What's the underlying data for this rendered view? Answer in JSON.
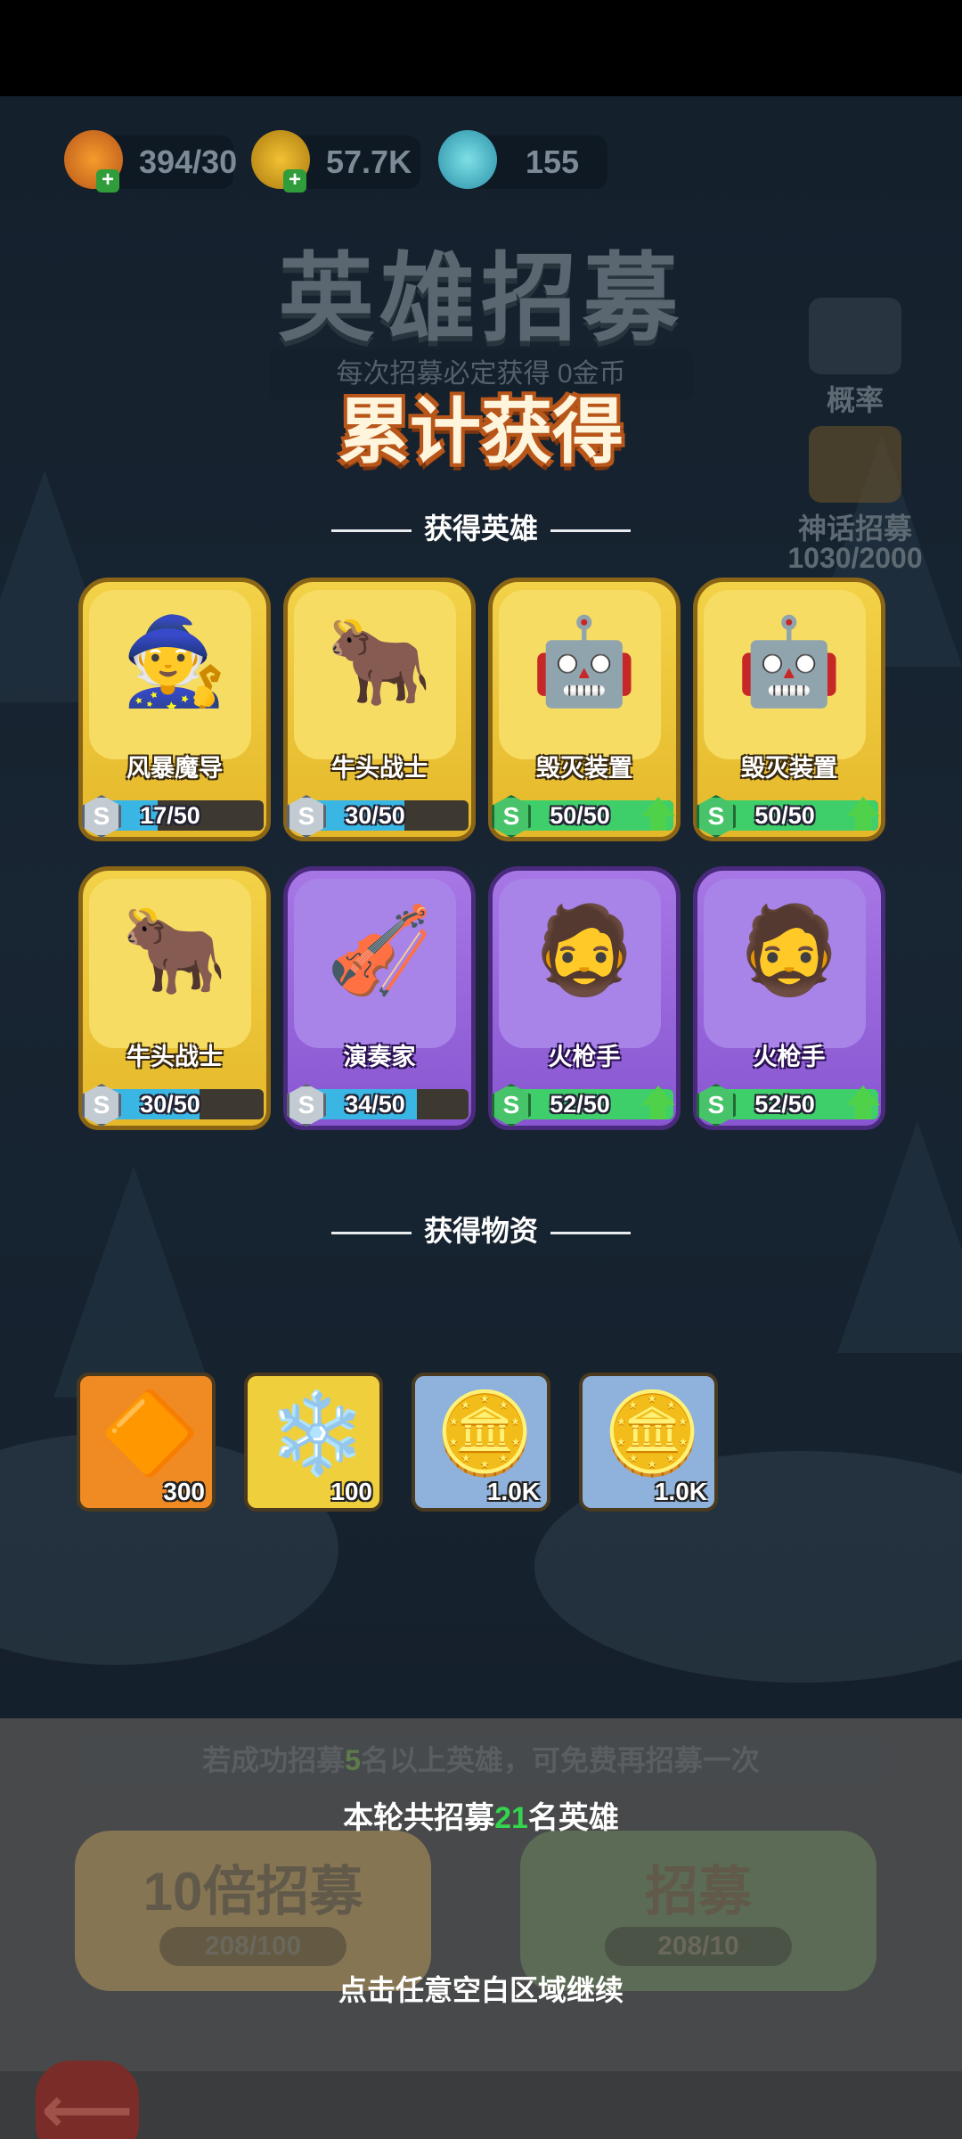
{
  "resources": [
    {
      "name": "fire-crystal-icon",
      "value": "394/30"
    },
    {
      "name": "gold-coin-icon",
      "value": "57.7K"
    },
    {
      "name": "ice-crystal-icon",
      "value": "155"
    }
  ],
  "background": {
    "title": "英雄招募",
    "subtitle": "每次招募必定获得 0金币",
    "odds_label": "概率",
    "mythic_label": "神话招募",
    "mythic_progress": "1030/2000"
  },
  "panel": {
    "title": "累计获得",
    "heroes_section": "获得英雄",
    "items_section": "获得物资"
  },
  "heroes": [
    {
      "name": "风暴魔导",
      "progress": "17/50",
      "fraction": 0.34,
      "rarity": "gold",
      "art": "🧙",
      "badge": "S"
    },
    {
      "name": "牛头战士",
      "progress": "30/50",
      "fraction": 0.6,
      "rarity": "gold",
      "art": "🐂",
      "badge": "S"
    },
    {
      "name": "毁灭装置",
      "progress": "50/50",
      "fraction": 1.0,
      "rarity": "gold",
      "art": "🤖",
      "badge": "S"
    },
    {
      "name": "毁灭装置",
      "progress": "50/50",
      "fraction": 1.0,
      "rarity": "gold",
      "art": "🤖",
      "badge": "S"
    },
    {
      "name": "牛头战士",
      "progress": "30/50",
      "fraction": 0.6,
      "rarity": "gold",
      "art": "🐂",
      "badge": "S"
    },
    {
      "name": "演奏家",
      "progress": "34/50",
      "fraction": 0.68,
      "rarity": "purple",
      "art": "🎻",
      "badge": "S"
    },
    {
      "name": "火枪手",
      "progress": "52/50",
      "fraction": 1.0,
      "rarity": "purple",
      "art": "🧔",
      "badge": "S"
    },
    {
      "name": "火枪手",
      "progress": "52/50",
      "fraction": 1.0,
      "rarity": "purple",
      "art": "🧔",
      "badge": "S"
    }
  ],
  "items": [
    {
      "icon": "fire-crystal-icon",
      "glyph": "🔶",
      "count": "300",
      "bg": "#f08a22"
    },
    {
      "icon": "ice-crystal-icon",
      "glyph": "❄️",
      "count": "100",
      "bg": "#f0cf3c"
    },
    {
      "icon": "gold-coin-icon",
      "glyph": "🪙",
      "count": "1.0K",
      "bg": "#8fb2dc"
    },
    {
      "icon": "gold-coin-icon",
      "glyph": "🪙",
      "count": "1.0K",
      "bg": "#8fb2dc"
    }
  ],
  "recruit": {
    "bonus_hint_pre": "若成功招募",
    "bonus_hint_num": "5",
    "bonus_hint_post": "名以上英雄，可免费再招募一次",
    "summary_pre": "本轮共招募",
    "summary_num": "21",
    "summary_post": "名英雄",
    "ten_label": "10倍招募",
    "ten_cost": "208/100",
    "one_label": "招募",
    "one_cost": "208/10",
    "continue_hint": "点击任意空白区域继续"
  },
  "colors": {
    "progress_normal": "#3ab6e4",
    "progress_full": "#3fcf6a",
    "title_outline": "#b8561a"
  }
}
